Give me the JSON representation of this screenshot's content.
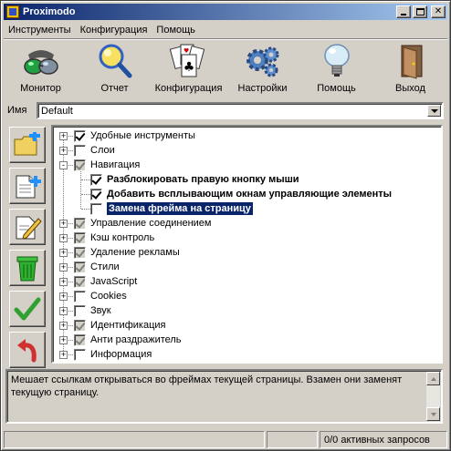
{
  "window": {
    "title": "Proximodo"
  },
  "menu": [
    "Инструменты",
    "Конфигурация",
    "Помощь"
  ],
  "toolbar": [
    {
      "label": "Монитор",
      "icon": "glasses-icon"
    },
    {
      "label": "Отчет",
      "icon": "magnifier-icon"
    },
    {
      "label": "Конфигурация",
      "icon": "cards-icon"
    },
    {
      "label": "Настройки",
      "icon": "gears-icon"
    },
    {
      "label": "Помощь",
      "icon": "lightbulb-icon"
    },
    {
      "label": "Выход",
      "icon": "door-icon"
    }
  ],
  "name": {
    "label": "Имя",
    "value": "Default"
  },
  "side_buttons": [
    "new-folder-icon",
    "new-filter-icon",
    "edit-icon",
    "trash-icon",
    "checkmark-icon",
    "undo-icon"
  ],
  "tree": [
    {
      "label": "Удобные инструменты",
      "level": 0,
      "expander": "+",
      "checked": true,
      "grey": false,
      "style": "normal"
    },
    {
      "label": "Слои",
      "level": 0,
      "expander": "+",
      "checked": false,
      "grey": false,
      "style": "normal"
    },
    {
      "label": "Навигация",
      "level": 0,
      "expander": "-",
      "checked": true,
      "grey": true,
      "style": "normal"
    },
    {
      "label": "Разблокировать правую кнопку мыши",
      "level": 1,
      "expander": "",
      "checked": true,
      "grey": false,
      "style": "bold"
    },
    {
      "label": "Добавить всплывающим окнам управляющие элементы",
      "level": 1,
      "expander": "",
      "checked": true,
      "grey": false,
      "style": "bold"
    },
    {
      "label": "Замена фрейма на страницу",
      "level": 1,
      "expander": "",
      "checked": false,
      "grey": false,
      "style": "selected"
    },
    {
      "label": "Управление соединением",
      "level": 0,
      "expander": "+",
      "checked": true,
      "grey": true,
      "style": "normal"
    },
    {
      "label": "Кэш контроль",
      "level": 0,
      "expander": "+",
      "checked": true,
      "grey": true,
      "style": "normal"
    },
    {
      "label": "Удаление рекламы",
      "level": 0,
      "expander": "+",
      "checked": true,
      "grey": true,
      "style": "normal"
    },
    {
      "label": "Стили",
      "level": 0,
      "expander": "+",
      "checked": true,
      "grey": true,
      "style": "normal"
    },
    {
      "label": "JavaScript",
      "level": 0,
      "expander": "+",
      "checked": true,
      "grey": true,
      "style": "normal"
    },
    {
      "label": "Cookies",
      "level": 0,
      "expander": "+",
      "checked": false,
      "grey": false,
      "style": "normal"
    },
    {
      "label": "Звук",
      "level": 0,
      "expander": "+",
      "checked": false,
      "grey": false,
      "style": "normal"
    },
    {
      "label": "Идентификация",
      "level": 0,
      "expander": "+",
      "checked": true,
      "grey": true,
      "style": "normal"
    },
    {
      "label": "Анти раздражитель",
      "level": 0,
      "expander": "+",
      "checked": true,
      "grey": true,
      "style": "normal"
    },
    {
      "label": "Информация",
      "level": 0,
      "expander": "+",
      "checked": false,
      "grey": false,
      "style": "normal"
    }
  ],
  "description": "Мешает ссылкам открываться во фреймах текущей страницы. Взамен они заменят текущую страницу.",
  "status": {
    "requests": "0/0 активных запросов"
  }
}
